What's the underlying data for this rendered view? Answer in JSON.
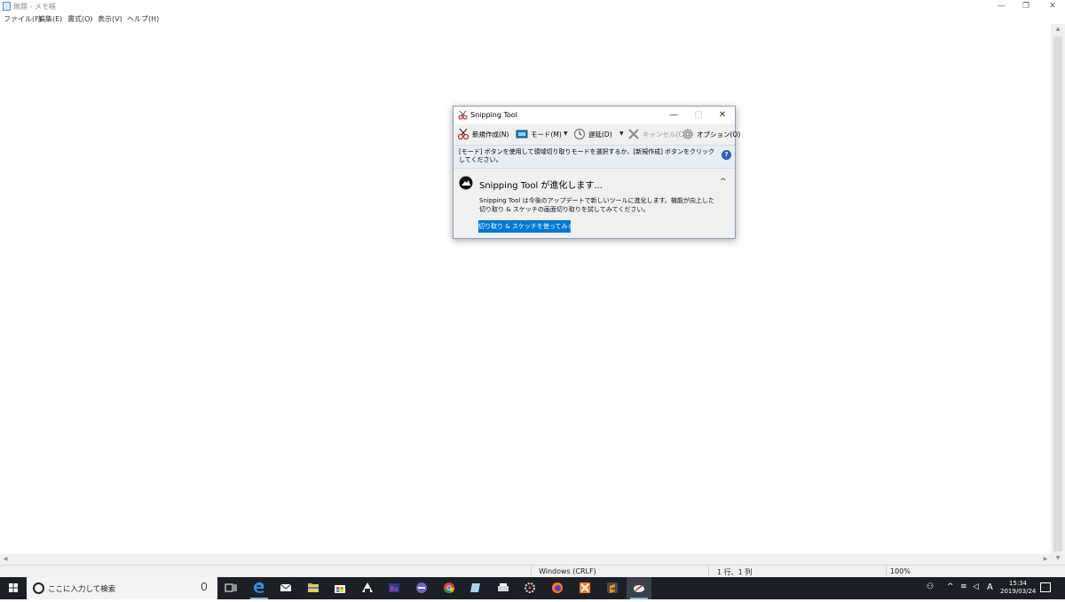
{
  "notepad": {
    "title": "無題 - メモ帳",
    "menu": [
      "ファイル(F)",
      "編集(E)",
      "書式(O)",
      "表示(V)",
      "ヘルプ(H)"
    ],
    "controls": {
      "minimize": "—",
      "restore": "❐",
      "close": "✕"
    },
    "status": {
      "encoding": "Windows (CRLF)",
      "position": "1 行、1 列",
      "zoom": "100%"
    }
  },
  "snipping_tool": {
    "title": "Snipping Tool",
    "controls": {
      "minimize": "—",
      "maximize": "□",
      "close": "✕"
    },
    "toolbar": {
      "new": "新規作成(N)",
      "mode": "モード(M)",
      "delay": "遅延(D)",
      "cancel": "キャンセル(C)",
      "options": "オプション(O)"
    },
    "info": "[モード] ボタンを使用して領域切り取りモードを選択するか、[新規作成] ボタンをクリックしてください。",
    "promo": {
      "title": "Snipping  Tool が進化します...",
      "description": "Snipping Tool は今後のアップデートで新しいツールに進化します。機能が向上した切り取り & スケッチの画面切り取りを試してみてください。",
      "button": "切り取り & スケッチを使ってみる"
    }
  },
  "taskbar": {
    "search_placeholder": "ここに入力して検索",
    "time": "15:34",
    "date": "2019/03/24",
    "ime": "A"
  },
  "colors": {
    "accent": "#0078d7",
    "taskbar": "#1c2026",
    "info_bar": "#e8eef5"
  }
}
